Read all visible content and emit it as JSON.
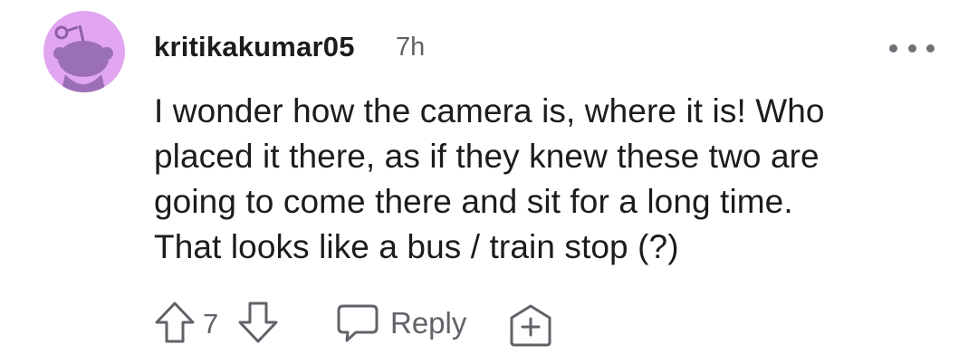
{
  "comment": {
    "username": "kritikakumar05",
    "timestamp": "7h",
    "body_lines": [
      "I wonder how the camera is, where it is! Who",
      "placed it there, as if they knew these two are",
      "going to come there and sit for a long time.",
      "That looks like a bus / train stop (?)"
    ],
    "vote_count": "7",
    "reply_label": "Reply"
  },
  "icons": {
    "avatar": "reddit-snoo-avatar",
    "more": "more-options-icon",
    "upvote": "upvote-arrow-icon",
    "downvote": "downvote-arrow-icon",
    "reply": "speech-bubble-icon",
    "award": "award-plus-icon"
  },
  "colors": {
    "avatar_bg": "#e2a6f0",
    "avatar_snoo": "#9b6fb5",
    "muted": "#5f6368",
    "text": "#1c1c1c"
  }
}
